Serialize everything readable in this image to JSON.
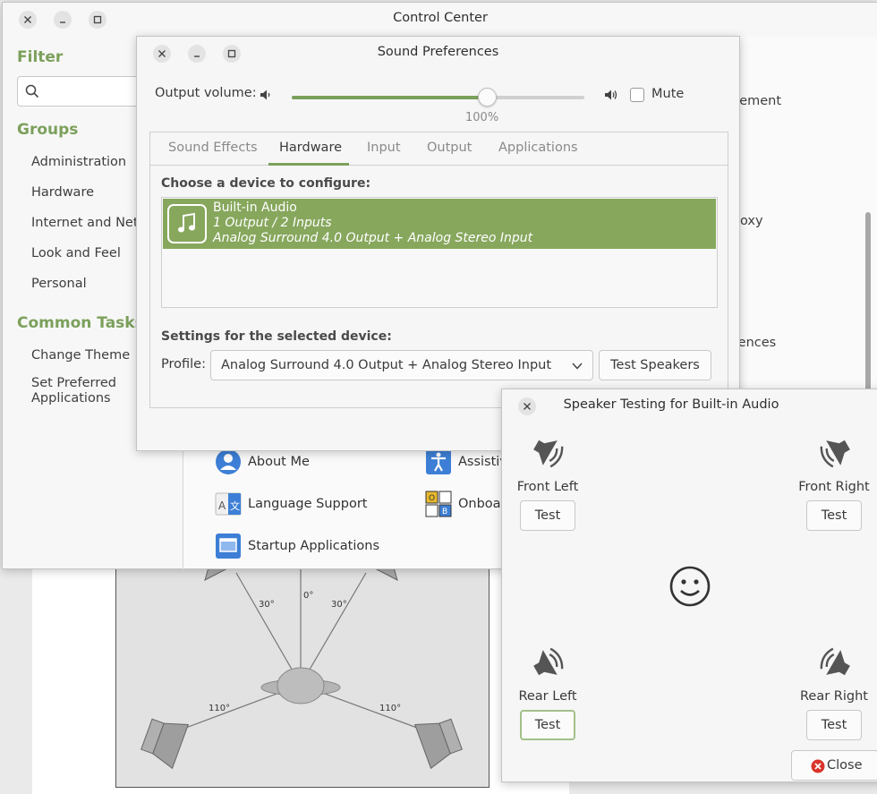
{
  "control_center": {
    "title": "Control Center",
    "filter_heading": "Filter",
    "search_placeholder": "",
    "groups_heading": "Groups",
    "groups": [
      "Administration",
      "Hardware",
      "Internet and Network",
      "Look and Feel",
      "Personal"
    ],
    "common_tasks_heading": "Common Tasks",
    "tasks": [
      "Change Theme",
      "Set Preferred Applications"
    ],
    "right_partials": [
      "gement",
      "oxy",
      "rences"
    ],
    "apps": [
      {
        "label": "About Me",
        "icon": "user-icon"
      },
      {
        "label": "Assistive Technologies",
        "icon": "accessibility-icon"
      },
      {
        "label": "Language Support",
        "icon": "language-icon"
      },
      {
        "label": "Onboard",
        "icon": "keyboard-grid-icon"
      },
      {
        "label": "Startup Applications",
        "icon": "window-icon"
      }
    ]
  },
  "sound_prefs": {
    "title": "Sound Preferences",
    "output_volume_label": "Output volume:",
    "volume_percent": 100,
    "volume_text": "100%",
    "mute_label": "Mute",
    "tabs": [
      "Sound Effects",
      "Hardware",
      "Input",
      "Output",
      "Applications"
    ],
    "active_tab": "Hardware",
    "choose_label": "Choose a device to configure:",
    "device": {
      "name": "Built-in Audio",
      "io": "1 Output / 2 Inputs",
      "profile": "Analog Surround 4.0 Output + Analog Stereo Input",
      "icon": "music-note-icon"
    },
    "settings_label": "Settings for the selected device:",
    "profile_label": "Profile:",
    "profile_value": "Analog Surround 4.0 Output + Analog Stereo Input",
    "test_speakers_label": "Test Speakers"
  },
  "speaker_test": {
    "title": "Speaker Testing for Built-in Audio",
    "speakers": [
      {
        "name": "Front Left",
        "button": "Test"
      },
      {
        "name": "Front Right",
        "button": "Test"
      },
      {
        "name": "Rear Left",
        "button": "Test"
      },
      {
        "name": "Rear Right",
        "button": "Test"
      }
    ],
    "close_label": "Close"
  },
  "diagram": {
    "angles": [
      "30°",
      "0°",
      "30°",
      "110°",
      "110°"
    ]
  },
  "colors": {
    "accent": "#7ba05b",
    "selection": "#87a75d",
    "close_red": "#d9342b"
  }
}
